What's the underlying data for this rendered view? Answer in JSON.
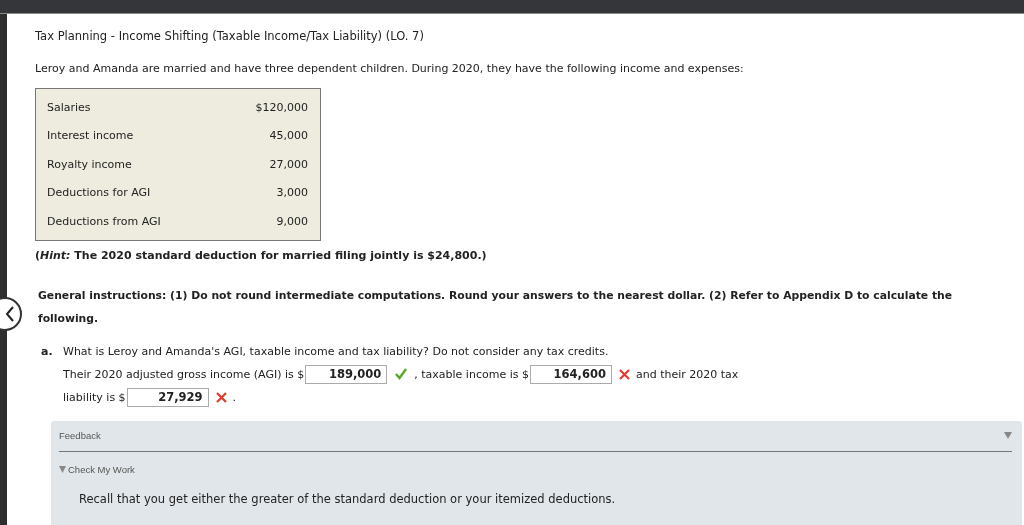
{
  "title": "Tax Planning - Income Shifting (Taxable Income/Tax Liability) (LO. 7)",
  "intro": "Leroy and Amanda are married and have three dependent children. During 2020, they have the following income and expenses:",
  "table": {
    "rows": [
      {
        "label": "Salaries",
        "value": "$120,000"
      },
      {
        "label": "Interest income",
        "value": "45,000"
      },
      {
        "label": "Royalty income",
        "value": "27,000"
      },
      {
        "label": "Deductions for AGI",
        "value": "3,000"
      },
      {
        "label": "Deductions from AGI",
        "value": "9,000"
      }
    ]
  },
  "hint": "(*Hint:* The 2020 standard deduction for married filing jointly is $24,800.)",
  "instructions": "General instructions: (1) Do not round intermediate computations. Round your answers to the nearest dollar. (2) Refer to Appendix D to calculate the following.",
  "question": {
    "marker": "a.",
    "text": "What is Leroy and Amanda's AGI, taxable income and tax liability? Do not consider any tax credits.",
    "lines": [
      [
        {
          "kind": "text",
          "text": "Their 2020 adjusted gross income (AGI) is $"
        },
        {
          "kind": "field",
          "value": "189,000",
          "correct": true
        },
        {
          "kind": "text",
          "text": ", taxable income is $"
        },
        {
          "kind": "field",
          "value": "164,600",
          "correct": false
        },
        {
          "kind": "text",
          "text": "and their 2020 tax"
        }
      ],
      [
        {
          "kind": "text",
          "text": "liability is $"
        },
        {
          "kind": "field",
          "value": "27,929",
          "correct": false
        },
        {
          "kind": "text",
          "text": "."
        }
      ]
    ]
  },
  "feedback": {
    "title": "Feedback",
    "expanded": true,
    "check_my_work": {
      "label": "Check My Work",
      "expanded": true
    },
    "text": "Recall that you get either the greater of the standard deduction or your itemized deductions."
  }
}
